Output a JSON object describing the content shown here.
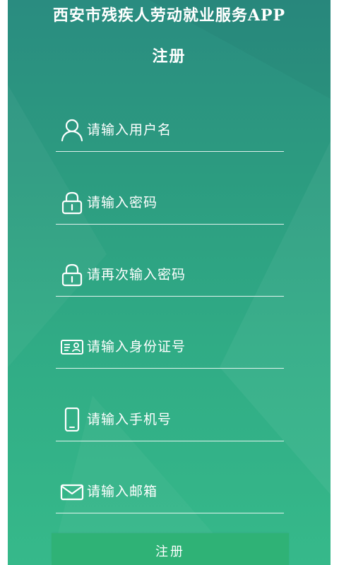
{
  "header": {
    "app_title": "西安市残疾人劳动就业服务APP",
    "page_title": "注册"
  },
  "form": {
    "fields": [
      {
        "placeholder": "请输入用户名",
        "icon": "user-icon"
      },
      {
        "placeholder": "请输入密码",
        "icon": "lock-icon"
      },
      {
        "placeholder": "请再次输入密码",
        "icon": "lock-icon"
      },
      {
        "placeholder": "请输入身份证号",
        "icon": "id-card-icon"
      },
      {
        "placeholder": "请输入手机号",
        "icon": "phone-icon"
      },
      {
        "placeholder": "请输入邮箱",
        "icon": "mail-icon"
      }
    ],
    "submit_label": "注册"
  },
  "colors": {
    "background_top": "#2a8c80",
    "background_bottom": "#36b98a",
    "button": "#2fb276",
    "text": "#ffffff"
  }
}
